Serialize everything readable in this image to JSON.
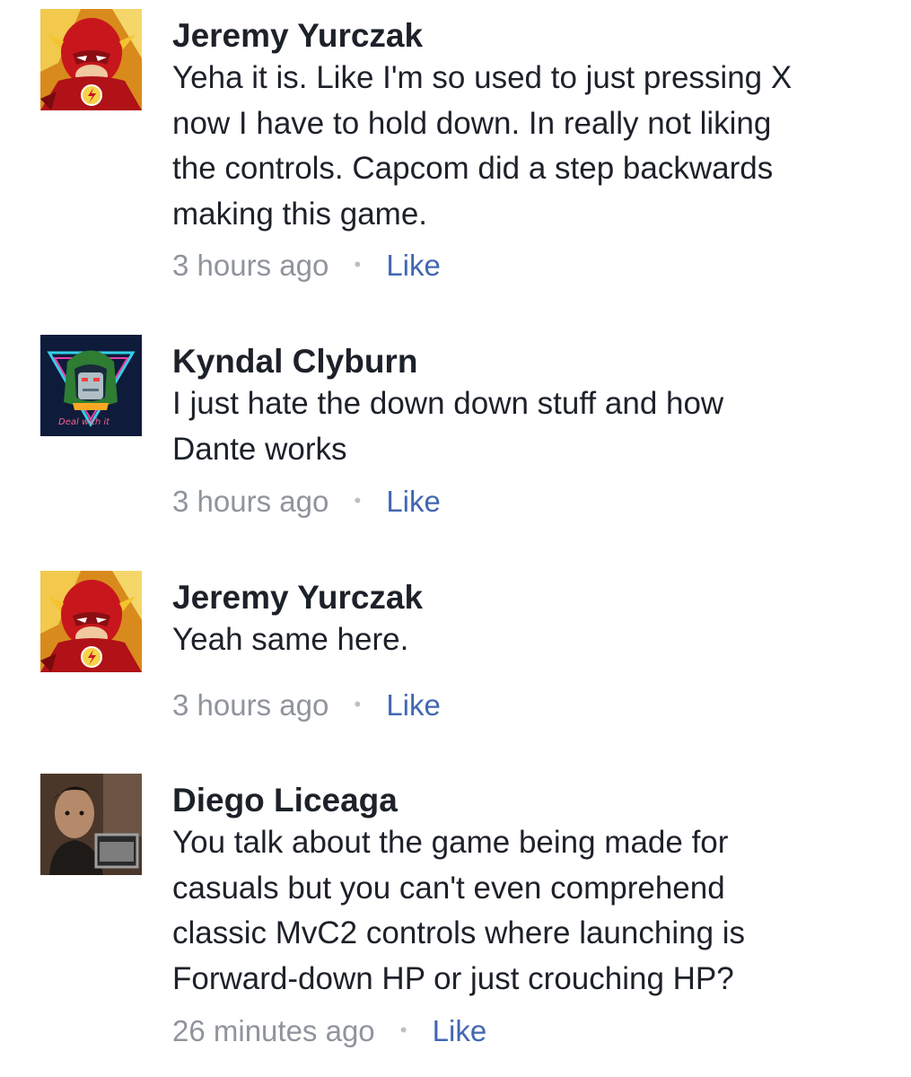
{
  "colors": {
    "text": "#1d2129",
    "meta": "#90949c",
    "link": "#4267b2",
    "background": "#ffffff"
  },
  "comments": [
    {
      "author": "Jeremy Yurczak",
      "avatar_icon": "flash-avatar",
      "text_lines": [
        "Yeha it is. Like I'm so used to just pressing X",
        "now I have to hold down. In really not liking",
        "the controls. Capcom did a step backwards",
        "making this game."
      ],
      "time": "3 hours ago",
      "separator": "•",
      "like_label": "Like"
    },
    {
      "author": "Kyndal Clyburn",
      "avatar_icon": "doom-avatar",
      "text_lines": [
        "I just hate the down down stuff and how",
        "Dante works"
      ],
      "time": "3 hours ago",
      "separator": "•",
      "like_label": "Like"
    },
    {
      "author": "Jeremy Yurczak",
      "avatar_icon": "flash-avatar",
      "text_lines": [
        "Yeah same here."
      ],
      "time": "3 hours ago",
      "separator": "•",
      "like_label": "Like"
    },
    {
      "author": "Diego Liceaga",
      "avatar_icon": "photo-avatar",
      "text_lines": [
        "You talk about the game being made for",
        "casuals but you can't even comprehend",
        "classic MvC2 controls where launching is",
        "Forward-down HP or just crouching HP?"
      ],
      "time": "26 minutes ago",
      "separator": "•",
      "like_label": "Like"
    }
  ]
}
